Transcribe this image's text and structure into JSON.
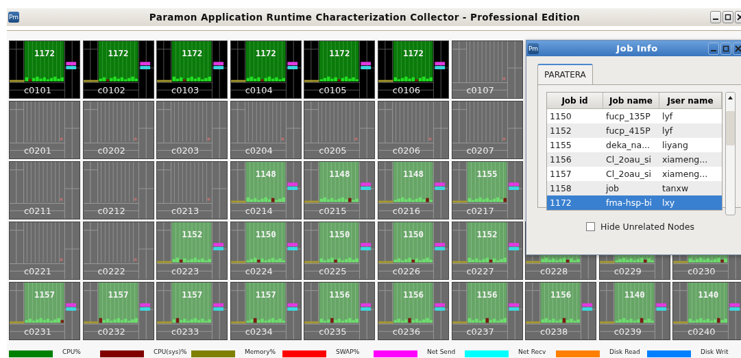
{
  "window": {
    "app_icon": "Pm",
    "title": "Paramon Application Runtime Characterization Collector - Professional Edition"
  },
  "node_rows": [
    {
      "tiles": [
        {
          "name": "c0101",
          "job": "1172",
          "kind": "highlight"
        },
        {
          "name": "c0102",
          "job": "1172",
          "kind": "highlight"
        },
        {
          "name": "c0103",
          "job": "1172",
          "kind": "highlight"
        },
        {
          "name": "c0104",
          "job": "1172",
          "kind": "highlight"
        },
        {
          "name": "c0105",
          "job": "1172",
          "kind": "highlight"
        },
        {
          "name": "c0106",
          "job": "1172",
          "kind": "highlight"
        },
        {
          "name": "c0107",
          "kind": "idle"
        }
      ]
    },
    {
      "tiles": [
        {
          "name": "c0201",
          "kind": "idle"
        },
        {
          "name": "c0202",
          "kind": "idle"
        },
        {
          "name": "c0203",
          "kind": "idle"
        },
        {
          "name": "c0204",
          "kind": "idle"
        },
        {
          "name": "c0205",
          "kind": "idle"
        },
        {
          "name": "c0206",
          "kind": "idle"
        },
        {
          "name": "c0207",
          "kind": "idle"
        }
      ]
    },
    {
      "tiles": [
        {
          "name": "c0211",
          "kind": "idle"
        },
        {
          "name": "c0212",
          "kind": "idle"
        },
        {
          "name": "c0213",
          "kind": "idle"
        },
        {
          "name": "c0214",
          "job": "1148",
          "kind": "active"
        },
        {
          "name": "c0215",
          "job": "1148",
          "kind": "active"
        },
        {
          "name": "c0216",
          "job": "1148",
          "kind": "active"
        },
        {
          "name": "c0217",
          "job": "1155",
          "kind": "active"
        }
      ]
    },
    {
      "tiles": [
        {
          "name": "c0221",
          "kind": "idle"
        },
        {
          "name": "c0222",
          "kind": "idle"
        },
        {
          "name": "c0223",
          "job": "1152",
          "kind": "active"
        },
        {
          "name": "c0224",
          "job": "1150",
          "kind": "active"
        },
        {
          "name": "c0225",
          "job": "1150",
          "kind": "active"
        },
        {
          "name": "c0226",
          "job": "1150",
          "kind": "active"
        },
        {
          "name": "c0227",
          "job": "1152",
          "kind": "active"
        },
        {
          "name": "c0228",
          "kind": "active"
        },
        {
          "name": "c0229",
          "kind": "active"
        },
        {
          "name": "c0230",
          "kind": "active"
        }
      ]
    },
    {
      "tiles": [
        {
          "name": "c0231",
          "job": "1157",
          "kind": "active"
        },
        {
          "name": "c0232",
          "job": "1157",
          "kind": "active"
        },
        {
          "name": "c0233",
          "job": "1157",
          "kind": "active"
        },
        {
          "name": "c0234",
          "job": "1157",
          "kind": "active"
        },
        {
          "name": "c0235",
          "job": "1156",
          "kind": "active"
        },
        {
          "name": "c0236",
          "job": "1156",
          "kind": "active"
        },
        {
          "name": "c0237",
          "job": "1156",
          "kind": "active"
        },
        {
          "name": "c0238",
          "job": "1156",
          "kind": "active"
        },
        {
          "name": "c0239",
          "job": "1140",
          "kind": "active"
        },
        {
          "name": "c0240",
          "job": "1140",
          "kind": "active"
        }
      ]
    }
  ],
  "legend": [
    {
      "label": "CPU%",
      "color": "#008000"
    },
    {
      "label": "CPU(sys)%",
      "color": "#800000"
    },
    {
      "label": "Memory%",
      "color": "#808000"
    },
    {
      "label": "SWAP%",
      "color": "#ff0000"
    },
    {
      "label": "Net Send",
      "color": "#ff00ff"
    },
    {
      "label": "Net Recv",
      "color": "#00ffff"
    },
    {
      "label": "Disk Read",
      "color": "#ff8000"
    },
    {
      "label": "Disk Writ",
      "color": "#0080ff"
    }
  ],
  "job_info": {
    "app_icon": "Pm",
    "title": "Job Info",
    "tabs": [
      {
        "label": "PARATERA",
        "selected": true
      }
    ],
    "columns": [
      "Job id",
      "Job name",
      "Jser name"
    ],
    "rows": [
      {
        "cells": [
          "1150",
          "fucp_135P",
          "lyf"
        ],
        "selected": false
      },
      {
        "cells": [
          "1152",
          "fucp_415P",
          "lyf"
        ],
        "selected": false
      },
      {
        "cells": [
          "1155",
          "deka_na...",
          "liyang"
        ],
        "selected": false
      },
      {
        "cells": [
          "1156",
          "Cl_2oau_si",
          "xiameng..."
        ],
        "selected": false
      },
      {
        "cells": [
          "1157",
          "Cl_2oau_si",
          "xiameng..."
        ],
        "selected": false
      },
      {
        "cells": [
          "1158",
          "job",
          "tanxw"
        ],
        "selected": false
      },
      {
        "cells": [
          "1172",
          "fma-hsp-bi",
          "lxy"
        ],
        "selected": true
      }
    ],
    "hide_unrelated": {
      "label": "Hide Unrelated Nodes",
      "checked": false
    }
  }
}
